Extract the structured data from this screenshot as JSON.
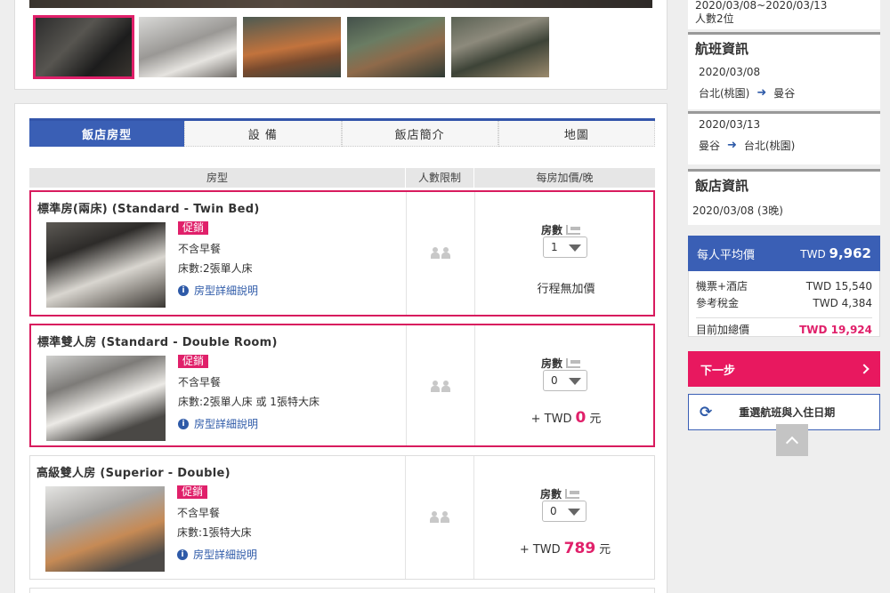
{
  "tabs": [
    {
      "label": "飯店房型",
      "active": true
    },
    {
      "label": "設 備",
      "active": false
    },
    {
      "label": "飯店簡介",
      "active": false
    },
    {
      "label": "地圖",
      "active": false
    }
  ],
  "table": {
    "headers": [
      "房型",
      "人數限制",
      "每房加價/晚"
    ]
  },
  "rooms": [
    {
      "name": "標準房(兩床) (Standard - Twin Bed)",
      "promo": "促銷",
      "meal": "不含早餐",
      "bed": "床數:2張單人床",
      "detail_link": "房型詳細說明",
      "rooms_label": "房數",
      "qty": "1",
      "price_note": "行程無加價"
    },
    {
      "name": "標準雙人房 (Standard - Double Room)",
      "promo": "促銷",
      "meal": "不含早餐",
      "bed": "床數:2張單人床 或 1張特大床",
      "detail_link": "房型詳細說明",
      "rooms_label": "房數",
      "qty": "0",
      "price_prefix": "+ TWD",
      "price_amount": "0",
      "price_unit": "元"
    },
    {
      "name": "高級雙人房 (Superior - Double)",
      "promo": "促銷",
      "meal": "不含早餐",
      "bed": "床數:1張特大床",
      "detail_link": "房型詳細說明",
      "rooms_label": "房數",
      "qty": "0",
      "price_prefix": "+ TWD",
      "price_amount": "789",
      "price_unit": "元"
    }
  ],
  "sidebar": {
    "trip_dates": "2020/03/08~2020/03/13",
    "pax": "人數2位",
    "flight_title": "航班資訊",
    "flights": [
      {
        "date": "2020/03/08",
        "from": "台北(桃園)",
        "to": "曼谷"
      },
      {
        "date": "2020/03/13",
        "from": "曼谷",
        "to": "台北(桃園)"
      }
    ],
    "hotel_title": "飯店資訊",
    "hotel_nights": "2020/03/08 (3晚)",
    "avg_label": "每人平均價",
    "avg_currency": "TWD",
    "avg_value": "9,962",
    "costs": [
      {
        "label": "機票+酒店",
        "value": "TWD 15,540"
      },
      {
        "label": "參考稅金",
        "value": "TWD 4,384"
      }
    ],
    "total_label": "目前加總價",
    "total_value": "TWD 19,924",
    "next_label": "下一步",
    "reset_label": "重選航班與入住日期"
  },
  "colors": {
    "brand_blue": "#3a5fb5",
    "accent_pink": "#e0206a"
  }
}
